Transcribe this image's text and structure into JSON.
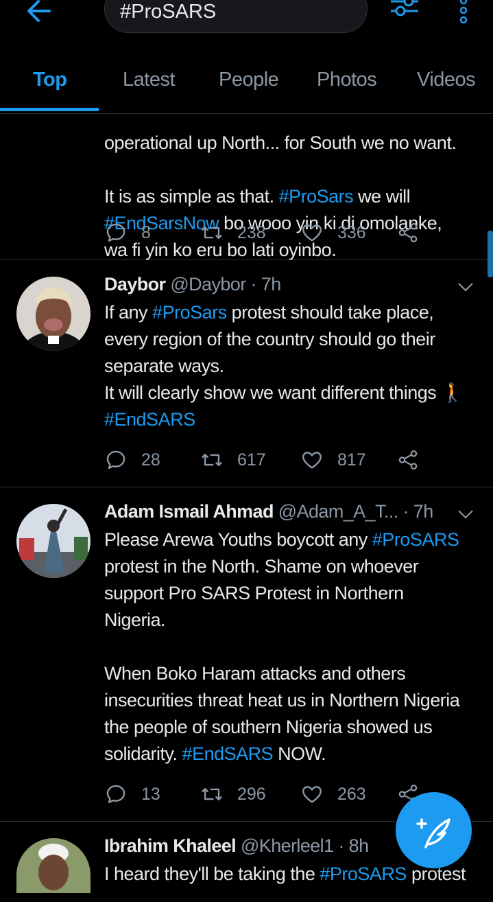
{
  "search": {
    "query": "#ProSARS"
  },
  "tabs": [
    "Top",
    "Latest",
    "People",
    "Photos",
    "Videos"
  ],
  "active_tab": "Top",
  "tweets": [
    {
      "partial_line": "operational up North... for South we no want.",
      "text_parts": [
        {
          "t": "It is as simple as that. ",
          "tag": false
        },
        {
          "t": "#ProSars",
          "tag": true
        },
        {
          "t": " we will\n",
          "tag": false
        },
        {
          "t": "#EndSarsNow",
          "tag": true
        },
        {
          "t": " bo wooo yin ki di omolanke,\nwa fi yin ko eru bo lati oyinbo.",
          "tag": false
        }
      ],
      "replies": "8",
      "retweets": "238",
      "likes": "336"
    },
    {
      "name": "Daybor",
      "handle": "@Daybor",
      "time": "· 7h",
      "text_parts": [
        {
          "t": "If any ",
          "tag": false
        },
        {
          "t": "#ProSars",
          "tag": true
        },
        {
          "t": " protest should take place,\nevery region of the country should go their\nseparate ways.\nIt will clearly show we want different things 🚶\n",
          "tag": false
        },
        {
          "t": "#EndSARS",
          "tag": true
        }
      ],
      "replies": "28",
      "retweets": "617",
      "likes": "817"
    },
    {
      "name": "Adam Ismail Ahmad",
      "handle": "@Adam_A_T...",
      "time": "· 7h",
      "text_parts": [
        {
          "t": "Please Arewa Youths boycott any ",
          "tag": false
        },
        {
          "t": "#ProSARS",
          "tag": true
        },
        {
          "t": "\nprotest in the North.  Shame on whoever\nsupport Pro SARS Protest in Northern\nNigeria.\n\nWhen Boko Haram attacks and others\ninsecurities threat heat us in Northern Nigeria\nthe people of southern Nigeria showed us\nsolidarity. ",
          "tag": false
        },
        {
          "t": "#EndSARS",
          "tag": true
        },
        {
          "t": " NOW.",
          "tag": false
        }
      ],
      "replies": "13",
      "retweets": "296",
      "likes": "263"
    },
    {
      "name": "Ibrahim Khaleel",
      "handle": "@Kherleel1",
      "time": "· 8h",
      "text_parts": [
        {
          "t": "I heard they'll be taking the ",
          "tag": false
        },
        {
          "t": "#ProSARS",
          "tag": true
        },
        {
          "t": " protest",
          "tag": false
        }
      ]
    }
  ],
  "icons": {
    "back": "arrow-left-icon",
    "filter": "sliders-icon",
    "more": "more-vertical-icon",
    "reply": "speech-bubble-icon",
    "retweet": "retweet-icon",
    "like": "heart-icon",
    "share": "share-icon",
    "compose": "compose-feather-icon"
  },
  "colors": {
    "accent": "#1d9bf0",
    "background": "#000000",
    "muted": "#8b98a5"
  }
}
